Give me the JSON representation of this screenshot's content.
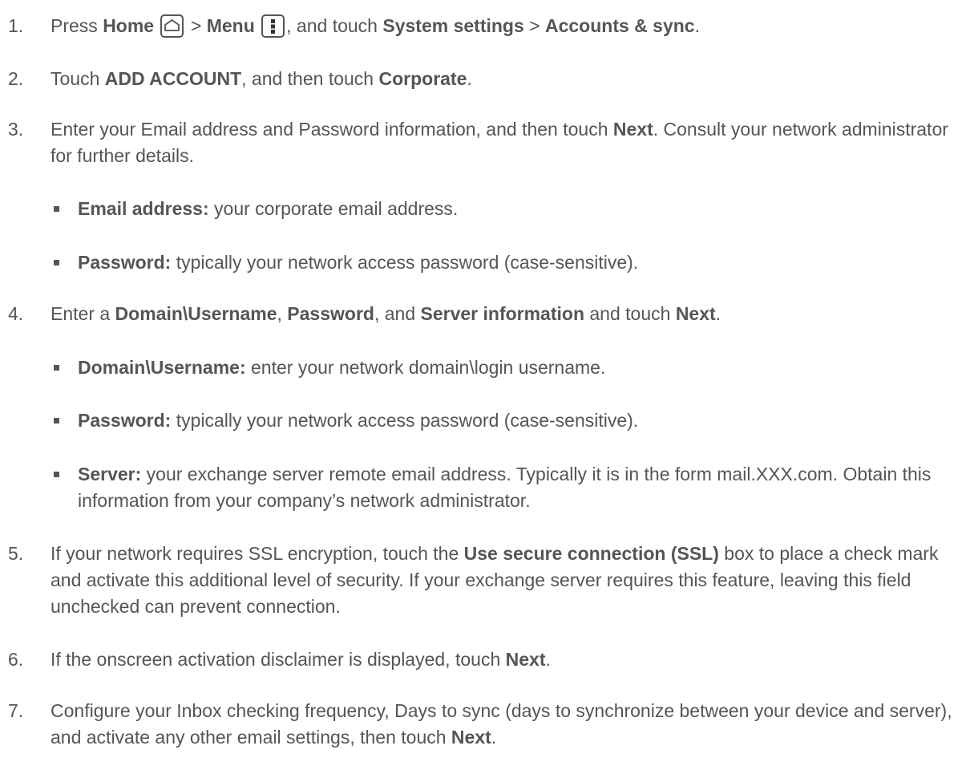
{
  "steps": [
    {
      "number": "1.",
      "parts": {
        "a": "Press ",
        "home": "Home",
        "b": " > ",
        "menu": "Menu",
        "c": ", and touch ",
        "system_settings": "System settings",
        "d": " > ",
        "accounts_sync": "Accounts & sync",
        "e": "."
      }
    },
    {
      "number": "2.",
      "parts": {
        "a": "Touch ",
        "add_account": "ADD ACCOUNT",
        "b": ", and then touch ",
        "corporate": "Corporate",
        "c": "."
      }
    },
    {
      "number": "3.",
      "parts": {
        "a": "Enter your Email address and Password information, and then touch ",
        "next": "Next",
        "b": ". Consult your network administrator for further details."
      },
      "bullets": [
        {
          "label": "Email address:",
          "text": " your corporate email address."
        },
        {
          "label": "Password:",
          "text": " typically your network access password (case-sensitive)."
        }
      ]
    },
    {
      "number": "4.",
      "parts": {
        "a": "Enter a ",
        "domain": "Domain\\Username",
        "b": ", ",
        "password": "Password",
        "c": ", and ",
        "server_info": "Server information",
        "d": " and touch ",
        "next": "Next",
        "e": "."
      },
      "bullets": [
        {
          "label": "Domain\\Username:",
          "text": " enter your network domain\\login username."
        },
        {
          "label": "Password:",
          "text": " typically your network access password (case-sensitive)."
        },
        {
          "label": "Server:",
          "text": " your exchange server remote email address. Typically it is in the form mail.XXX.com. Obtain this information from your company’s network administrator."
        }
      ]
    },
    {
      "number": "5.",
      "parts": {
        "a": "If your network requires SSL encryption, touch the ",
        "ssl": "Use secure connection (SSL)",
        "b": " box to place a check mark and activate this additional level of security. If your exchange server requires this feature, leaving this field unchecked can prevent connection."
      }
    },
    {
      "number": "6.",
      "parts": {
        "a": "If the onscreen activation disclaimer is displayed, touch ",
        "next": "Next",
        "b": "."
      }
    },
    {
      "number": "7.",
      "parts": {
        "a": "Configure your Inbox checking frequency, Days to sync (days to synchronize between your device and server), and activate any other email settings, then touch ",
        "next": "Next",
        "b": "."
      }
    }
  ],
  "icons": {
    "home": "home-key-icon",
    "menu": "menu-key-icon"
  },
  "colors": {
    "text": "#555555"
  }
}
